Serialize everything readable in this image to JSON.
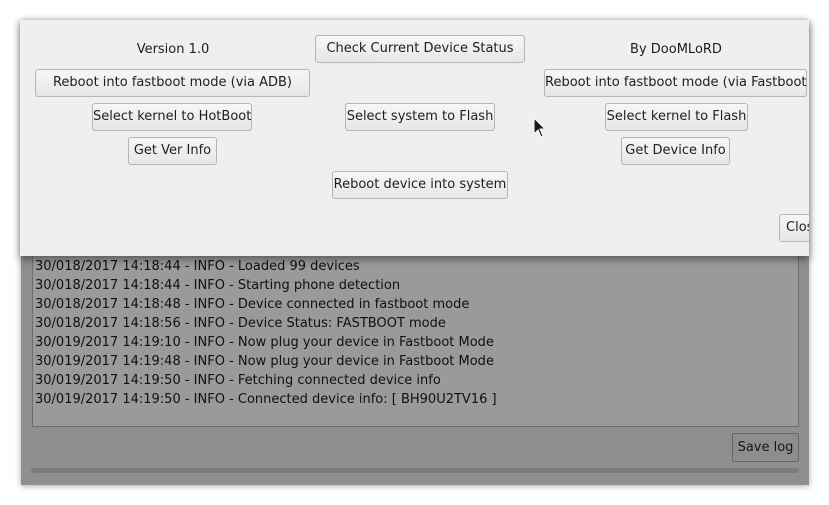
{
  "dialog": {
    "version_label": "Version 1.0",
    "author_label": "By DooMLoRD",
    "buttons": {
      "check_status": "Check Current Device Status",
      "reboot_fastboot_adb": "Reboot into fastboot mode (via ADB)",
      "reboot_fastboot_fastboot": "Reboot into fastboot mode (via Fastboot)",
      "select_kernel_hotboot": "Select kernel to HotBoot",
      "select_system_flash": "Select system to Flash",
      "select_kernel_flash": "Select kernel to Flash",
      "get_ver_info": "Get Ver Info",
      "get_device_info": "Get Device Info",
      "reboot_system": "Reboot device into system",
      "close": "Close"
    }
  },
  "log": {
    "lines": [
      "30/018/2017 14:18:44 - INFO  - Loaded 99 devices",
      "30/018/2017 14:18:44 - INFO  - Starting phone detection",
      "30/018/2017 14:18:48 - INFO  - Device connected in fastboot mode",
      "30/018/2017 14:18:56 - INFO  - Device Status: FASTBOOT mode",
      "30/019/2017 14:19:10 - INFO  - Now plug your device in Fastboot Mode",
      "30/019/2017 14:19:48 - INFO  - Now plug your device in Fastboot Mode",
      "30/019/2017 14:19:50 - INFO  - Fetching connected device info",
      "30/019/2017 14:19:50 - INFO  - Connected device info: [ BH90U2TV16 ]"
    ],
    "save_label": "Save log"
  },
  "icons": {
    "cursor": "mouse-pointer-icon"
  }
}
